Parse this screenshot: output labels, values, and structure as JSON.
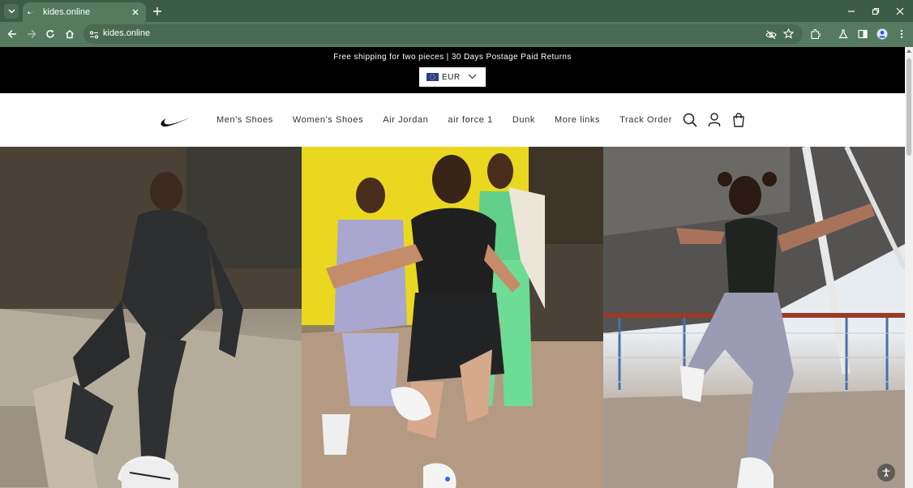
{
  "browser": {
    "tab_title": "kides.online",
    "url": "kides.online",
    "frame_color": "#3d5c45",
    "toolbar_color": "#557a5e"
  },
  "announcement": {
    "text": "Free shipping for two pieces | 30 Days Postage Paid Returns",
    "currency": "EUR"
  },
  "nav": {
    "items": [
      "Men's Shoes",
      "Women's Shoes",
      "Air Jordan",
      "air force 1",
      "Dunk",
      "More links",
      "Track Order"
    ]
  },
  "icons": {
    "logo": "swoosh-logo",
    "search": "search-icon",
    "account": "account-icon",
    "cart": "cart-icon"
  },
  "hero": {
    "panels": [
      "dancer-on-bridge-steps",
      "three-friends-yellow-wall",
      "dancer-under-bridge"
    ]
  }
}
